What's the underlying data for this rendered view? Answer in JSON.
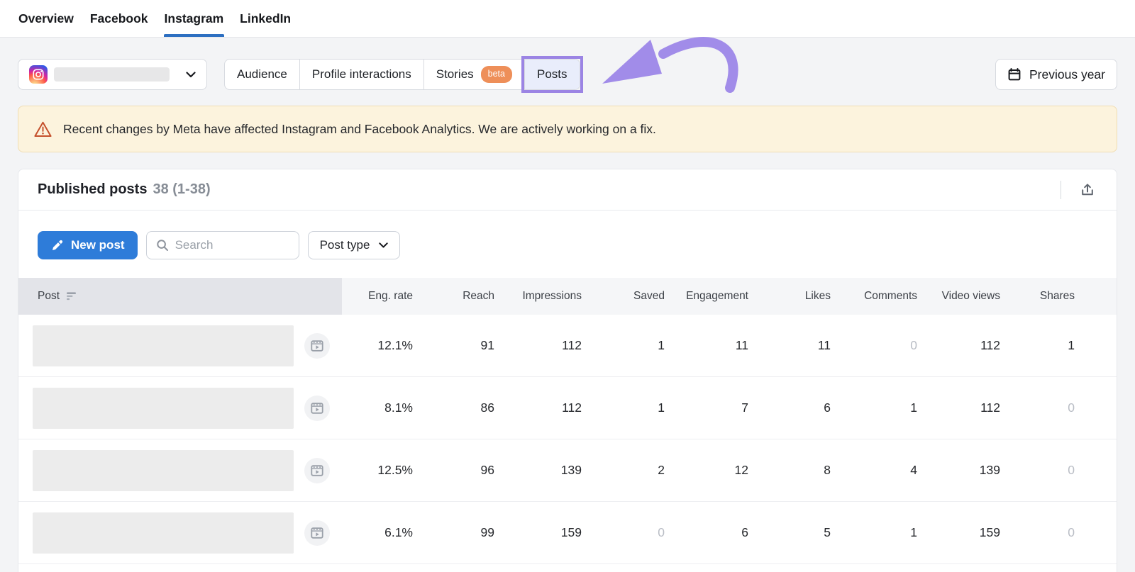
{
  "nav": {
    "tabs": [
      {
        "label": "Overview"
      },
      {
        "label": "Facebook"
      },
      {
        "label": "Instagram"
      },
      {
        "label": "LinkedIn"
      }
    ],
    "active_tab": "Instagram"
  },
  "toolbar": {
    "account_selector": {
      "network": "Instagram",
      "name_hidden": true
    },
    "subtabs": {
      "audience": "Audience",
      "profile_interactions": "Profile interactions",
      "stories": "Stories",
      "stories_badge": "beta",
      "posts": "Posts",
      "selected": "Posts"
    },
    "date_button": {
      "label": "Previous year"
    }
  },
  "banner": {
    "text": "Recent changes by Meta have affected Instagram and Facebook Analytics. We are actively working on a fix."
  },
  "posts_panel": {
    "title": "Published posts",
    "count": "38 (1-38)",
    "new_post": "New post",
    "search_placeholder": "Search",
    "post_type": "Post type"
  },
  "table": {
    "columns": [
      "Post",
      "Eng. rate",
      "Reach",
      "Impressions",
      "Saved",
      "Engagement",
      "Likes",
      "Comments",
      "Video views",
      "Shares"
    ],
    "rows": [
      {
        "cells": [
          "12.1%",
          "91",
          "112",
          "1",
          "11",
          "11",
          "0",
          "112",
          "1"
        ],
        "muted": [
          6
        ],
        "media": "video"
      },
      {
        "cells": [
          "8.1%",
          "86",
          "112",
          "1",
          "7",
          "6",
          "1",
          "112",
          "0"
        ],
        "muted": [
          8
        ],
        "media": "video"
      },
      {
        "cells": [
          "12.5%",
          "96",
          "139",
          "2",
          "12",
          "8",
          "4",
          "139",
          "0"
        ],
        "muted": [
          8
        ],
        "media": "video"
      },
      {
        "cells": [
          "6.1%",
          "99",
          "159",
          "0",
          "6",
          "5",
          "1",
          "159",
          "0"
        ],
        "muted": [
          3,
          8
        ],
        "media": "video"
      }
    ]
  },
  "icons": {
    "account": "instagram-icon",
    "expanders": "chevron-down-icon",
    "date": "calendar-icon",
    "banner": "warning-triangle-icon",
    "export": "export-icon",
    "new_post": "pencil-icon",
    "search": "search-icon",
    "post_sort": "sort-descending-icon",
    "post_media": "video-reel-icon",
    "annotation": "purple-arrow-annotation"
  },
  "colors": {
    "accent_blue": "#2e7cd9",
    "tab_underline": "#2d6fc1",
    "annotation_purple": "#9b84e4",
    "beta_badge_orange": "#ee8f59",
    "banner_bg": "#fcf3dd",
    "selected_segment_bg": "#e9edfb",
    "muted_value": "#b9bdc5"
  }
}
